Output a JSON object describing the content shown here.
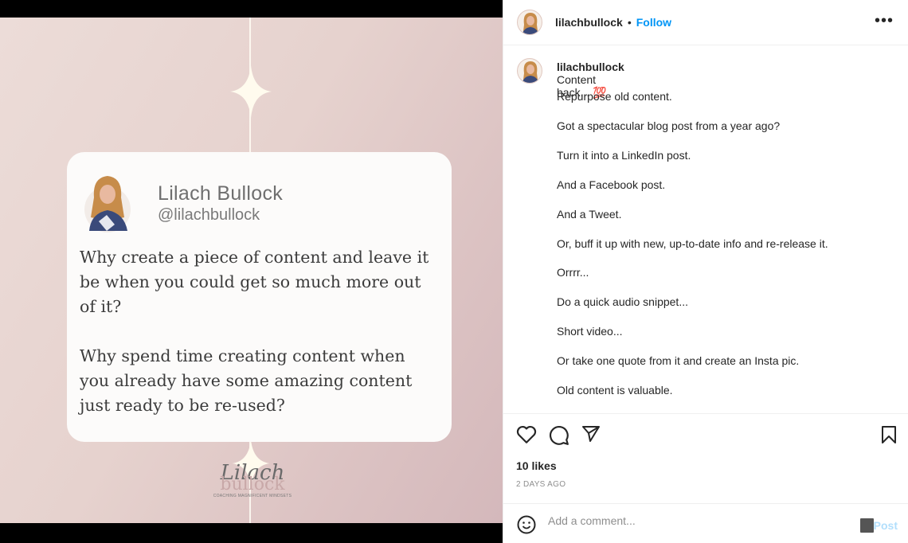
{
  "post_image": {
    "card": {
      "name": "Lilach Bullock",
      "handle": "@lilachbullock",
      "quote1": "Why create a piece of content and leave it be when you could get so much more out of it?",
      "quote2": "Why spend time creating content when you already have some amazing content just ready to be re-used?"
    },
    "logo": {
      "line1": "Lilach",
      "line2": "bullock",
      "tagline": "COACHING MAGNIFICENT MINDSETS"
    }
  },
  "header": {
    "username": "lilachbullock",
    "separator": "•",
    "follow_label": "Follow",
    "more_label": "•••"
  },
  "caption": {
    "username": "lilachbullock",
    "intro": "Content hack... 💯",
    "lines": [
      "Repurpose old content.",
      "Got a spectacular blog post from a year ago?",
      "Turn it into a LinkedIn post.",
      "And a Facebook post.",
      "And a Tweet.",
      "Or, buff it up with new, up-to-date info and re-release it.",
      "Orrrr...",
      "Do a quick audio snippet...",
      "Short video...",
      "Or take one quote from it and create an Insta pic.",
      "Old content is valuable."
    ]
  },
  "stats": {
    "likes": "10 likes",
    "time": "2 DAYS AGO"
  },
  "comment": {
    "placeholder": "Add a comment...",
    "post_label": "Post"
  },
  "colors": {
    "accent": "#0095f6",
    "post_disabled": "#b2dffc",
    "text": "#262626"
  }
}
